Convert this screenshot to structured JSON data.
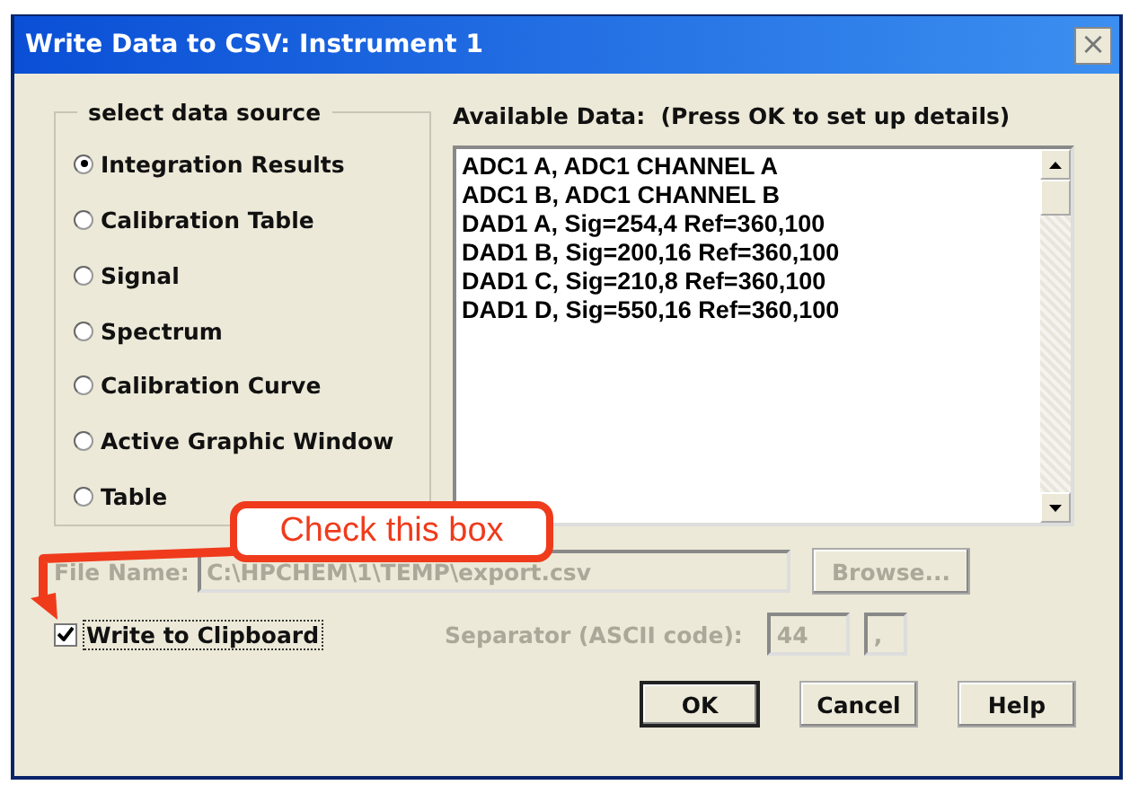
{
  "window": {
    "title": "Write Data to CSV: Instrument 1",
    "close": "×"
  },
  "source_group": {
    "title": "select data source",
    "options": [
      {
        "label": "Integration Results",
        "selected": true
      },
      {
        "label": "Calibration Table",
        "selected": false
      },
      {
        "label": "Signal",
        "selected": false
      },
      {
        "label": "Spectrum",
        "selected": false
      },
      {
        "label": "Calibration Curve",
        "selected": false
      },
      {
        "label": "Active Graphic Window",
        "selected": false
      },
      {
        "label": "Table",
        "selected": false
      }
    ]
  },
  "available": {
    "label": "Available Data:  (Press OK to set up details)",
    "items": [
      "ADC1 A, ADC1 CHANNEL A",
      "ADC1 B, ADC1 CHANNEL B",
      "DAD1 A, Sig=254,4 Ref=360,100",
      "DAD1 B, Sig=200,16 Ref=360,100",
      "DAD1 C, Sig=210,8 Ref=360,100",
      "DAD1 D, Sig=550,16 Ref=360,100"
    ]
  },
  "file_name": {
    "label": "File Name:",
    "value": "C:\\HPCHEM\\1\\TEMP\\export.csv",
    "disabled": true,
    "browse": "Browse..."
  },
  "clipboard": {
    "label": "Write to Clipboard",
    "checked": true
  },
  "separator": {
    "label": "Separator (ASCII code):",
    "code": "44",
    "char": ",",
    "disabled": true
  },
  "buttons": [
    "OK",
    "Cancel",
    "Help"
  ],
  "annotation": {
    "text": "Check this box"
  }
}
